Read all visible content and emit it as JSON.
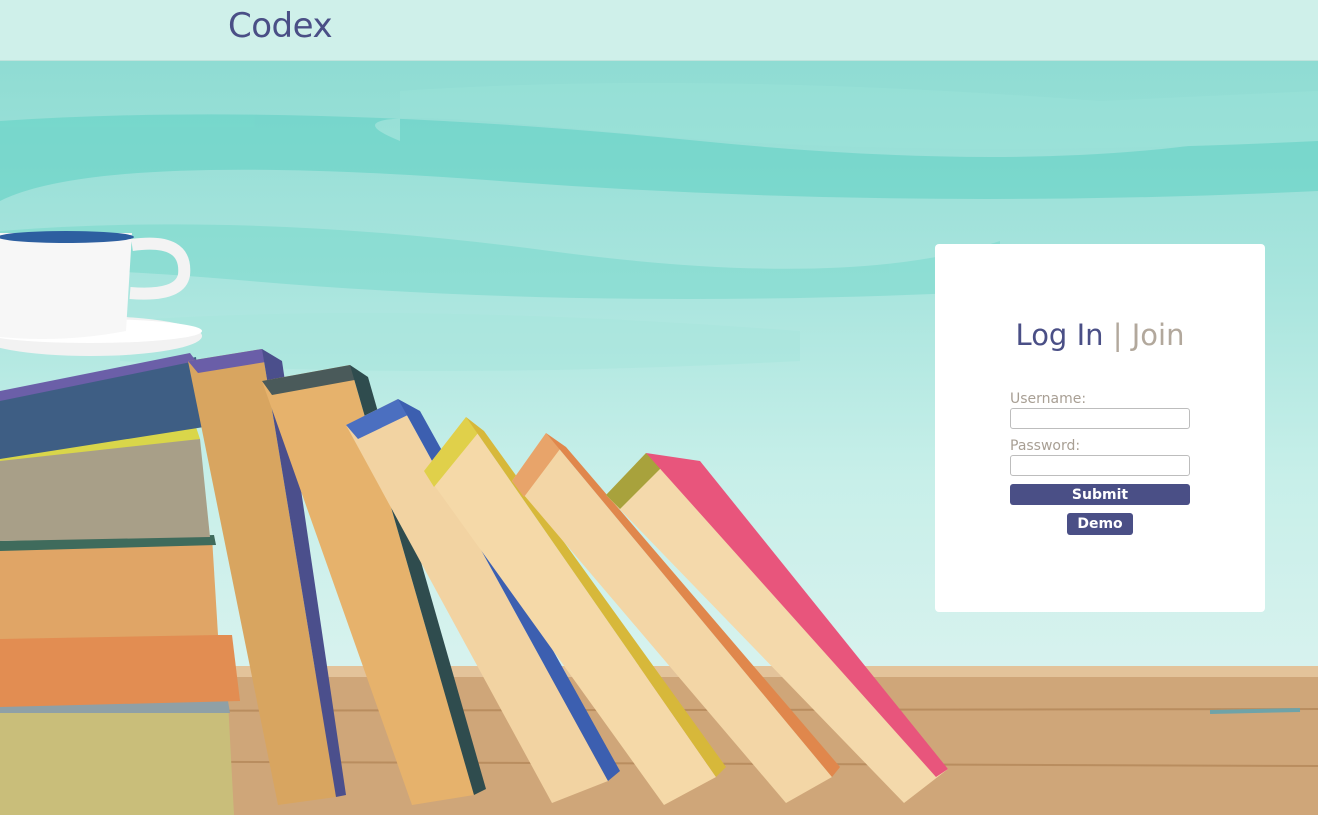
{
  "header": {
    "logo": "Codex"
  },
  "auth_card": {
    "tab_login": "Log In",
    "tab_separator": "|",
    "tab_join": "Join",
    "username_label": "Username:",
    "username_value": "",
    "password_label": "Password:",
    "password_value": "",
    "submit_label": "Submit",
    "demo_label": "Demo"
  },
  "colors": {
    "brand": "#4a4f86",
    "muted_text": "#b2a89c",
    "header_bg": "#cff0ea"
  }
}
